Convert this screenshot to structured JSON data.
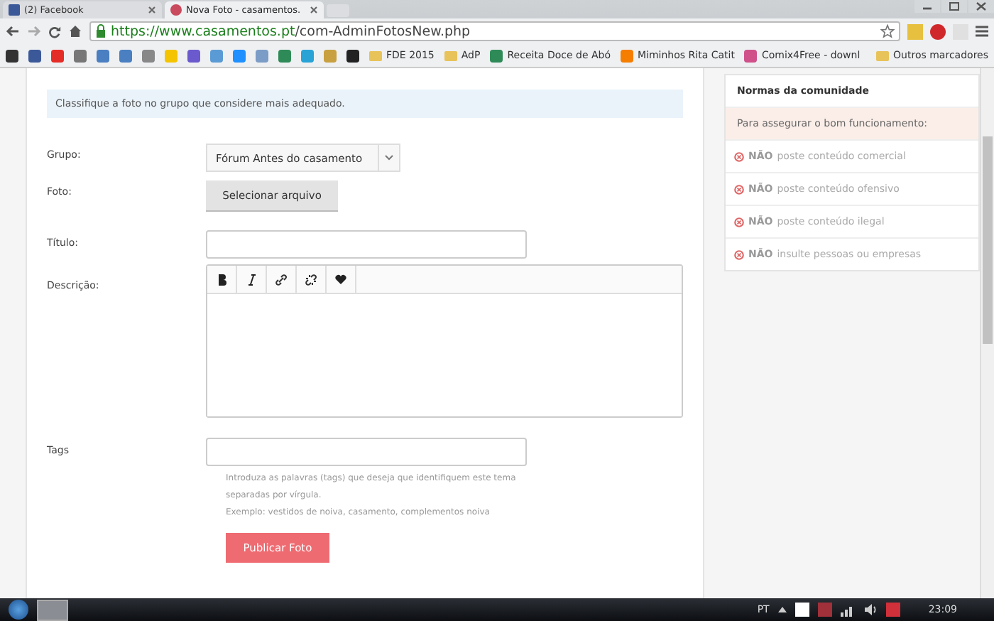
{
  "browser": {
    "tabs": [
      {
        "title": "(2) Facebook",
        "selected": false
      },
      {
        "title": "Nova Foto - casamentos.",
        "selected": true
      }
    ],
    "url": {
      "host": "https://www.casamentos.pt",
      "path": "/com-AdminFotosNew.php"
    },
    "bookmarks": [
      {
        "kind": "icon",
        "color": "#333333"
      },
      {
        "kind": "icon",
        "color": "#3b5998"
      },
      {
        "kind": "icon",
        "color": "#e52d27"
      },
      {
        "kind": "icon",
        "color": "#777777"
      },
      {
        "kind": "icon",
        "color": "#4a7fc1"
      },
      {
        "kind": "icon",
        "color": "#4a7fc1"
      },
      {
        "kind": "icon",
        "color": "#888888"
      },
      {
        "kind": "icon",
        "color": "#f5c400"
      },
      {
        "kind": "icon",
        "color": "#6a5acd"
      },
      {
        "kind": "icon",
        "color": "#5b9bd5"
      },
      {
        "kind": "icon",
        "color": "#1e90ff"
      },
      {
        "kind": "icon",
        "color": "#7a9cc6"
      },
      {
        "kind": "icon",
        "color": "#2e8b57"
      },
      {
        "kind": "icon",
        "color": "#29a3d6"
      },
      {
        "kind": "icon",
        "color": "#c8a040"
      },
      {
        "kind": "icon",
        "color": "#222222"
      },
      {
        "kind": "folder",
        "label": "FDE 2015"
      },
      {
        "kind": "folder",
        "label": "AdP"
      },
      {
        "kind": "site",
        "label": "Receita Doce de Abó",
        "color": "#2e8b57"
      },
      {
        "kind": "site",
        "label": "Miminhos Rita Catit",
        "color": "#f57d00"
      },
      {
        "kind": "site",
        "label": "Comix4Free - downl",
        "color": "#d0508a"
      }
    ],
    "other_bookmarks": "Outros marcadores"
  },
  "form": {
    "notice": "Classifique a foto no grupo que considere mais adequado.",
    "fields": [
      {
        "kind": "select",
        "label": "Grupo:",
        "value": "Fórum Antes do casamento"
      },
      {
        "kind": "file",
        "label": "Foto:",
        "value": "Selecionar arquivo"
      },
      {
        "kind": "text",
        "label": "Título:"
      },
      {
        "kind": "editor",
        "label": "Descrição:"
      },
      {
        "kind": "text",
        "label": "Tags"
      }
    ],
    "help": [
      "Introduza as palavras (tags) que deseja que identifiquem este tema",
      "separadas por vírgula.",
      "Exemplo: vestidos de noiva, casamento, complementos noiva"
    ],
    "submit": "Publicar Foto"
  },
  "sidebar": {
    "title": "Normas da comunidade",
    "subtitle": "Para assegurar o bom funcionamento:",
    "rules": [
      {
        "prefix": "NÃO",
        "text": "poste conteúdo comercial"
      },
      {
        "prefix": "NÃO",
        "text": "poste conteúdo ofensivo"
      },
      {
        "prefix": "NÃO",
        "text": "poste conteúdo ilegal"
      },
      {
        "prefix": "NÃO",
        "text": "insulte pessoas ou empresas"
      }
    ]
  },
  "taskbar": {
    "language": "PT",
    "time": "23:09"
  }
}
